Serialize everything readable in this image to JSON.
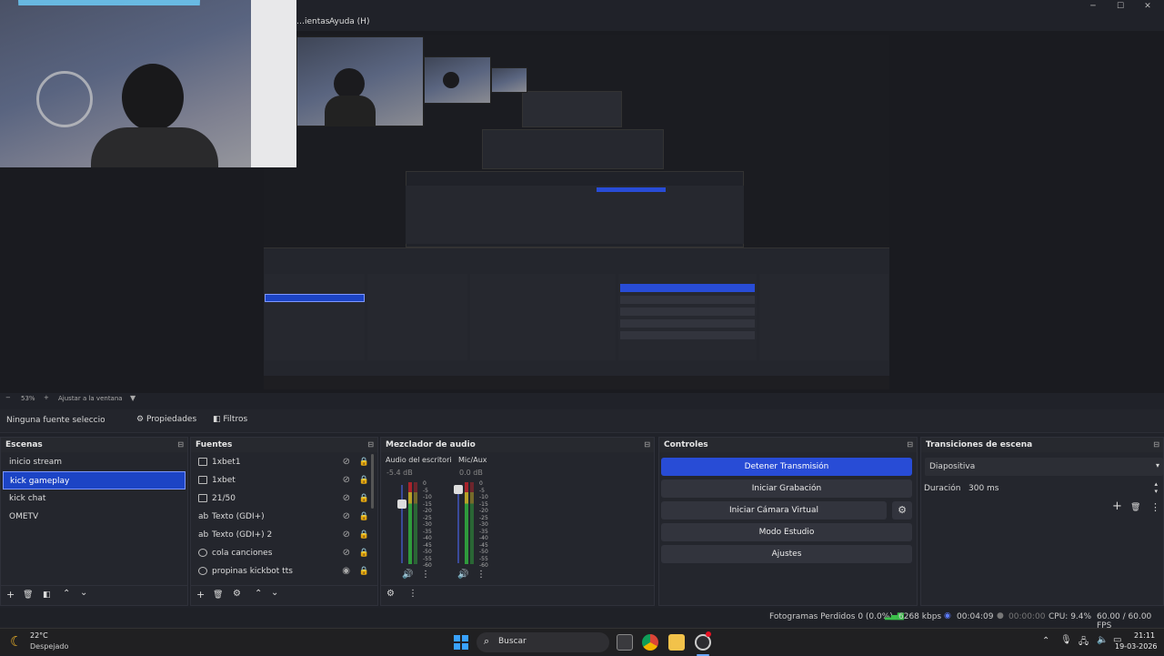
{
  "menu": {
    "items": [
      "…ientas",
      "Ayuda (H)"
    ],
    "window_controls": [
      "─",
      "☐",
      "✕"
    ]
  },
  "zoom": {
    "minus": "−",
    "value": "53%",
    "plus": "+",
    "fit_label": "Ajustar a la ventana"
  },
  "propbar": {
    "selected_source": "Ninguna fuente seleccionad",
    "properties_label": "Propiedades",
    "filters_label": "Filtros"
  },
  "scenes": {
    "title": "Escenas",
    "items": [
      "inicio stream",
      "kick gameplay",
      "kick chat",
      "OMETV"
    ],
    "selected_index": 1
  },
  "sources": {
    "title": "Fuentes",
    "items": [
      {
        "label": "1xbet1",
        "visible": false
      },
      {
        "label": "1xbet",
        "visible": false
      },
      {
        "label": "21/50",
        "visible": false
      },
      {
        "label": "Texto (GDI+)",
        "visible": false
      },
      {
        "label": "Texto (GDI+) 2",
        "visible": false
      },
      {
        "label": "cola canciones",
        "visible": false
      },
      {
        "label": "propinas kickbot tts",
        "visible": true
      }
    ]
  },
  "mixer": {
    "title": "Mezclador de audio",
    "channels": [
      {
        "name": "Audio del escritoric",
        "db": "-5.4 dB",
        "level": 0.75
      },
      {
        "name": "Mic/Aux",
        "db": "0.0 dB",
        "level": 1.0
      }
    ],
    "scale": [
      "0",
      "-5",
      "-10",
      "-15",
      "-20",
      "-25",
      "-30",
      "-35",
      "-40",
      "-45",
      "-50",
      "-55",
      "-60"
    ]
  },
  "controls": {
    "title": "Controles",
    "stop_stream": "Detener Transmisión",
    "start_recording": "Iniciar Grabación",
    "start_virtual_camera": "Iniciar Cámara Virtual",
    "studio_mode": "Modo Estudio",
    "settings": "Ajustes"
  },
  "transitions": {
    "title": "Transiciones de escena",
    "selected": "Diapositiva",
    "duration_label": "Duración",
    "duration_value": "300 ms"
  },
  "status": {
    "dropped_frames": "Fotogramas Perdidos 0 (0.0%)",
    "bitrate": "6268 kbps",
    "stream_time": "00:04:09",
    "record_time": "00:00:00",
    "cpu": "CPU: 9.4%",
    "fps": "60.00 / 60.00 FPS"
  },
  "taskbar": {
    "weather_temp": "22°C",
    "weather_desc": "Despejado",
    "search_placeholder": "Buscar",
    "time": "21:11",
    "date": "19-03-2026"
  },
  "colors": {
    "accent": "#284cd6",
    "selection": "#1c44c5",
    "panel_bg": "#24262d"
  }
}
